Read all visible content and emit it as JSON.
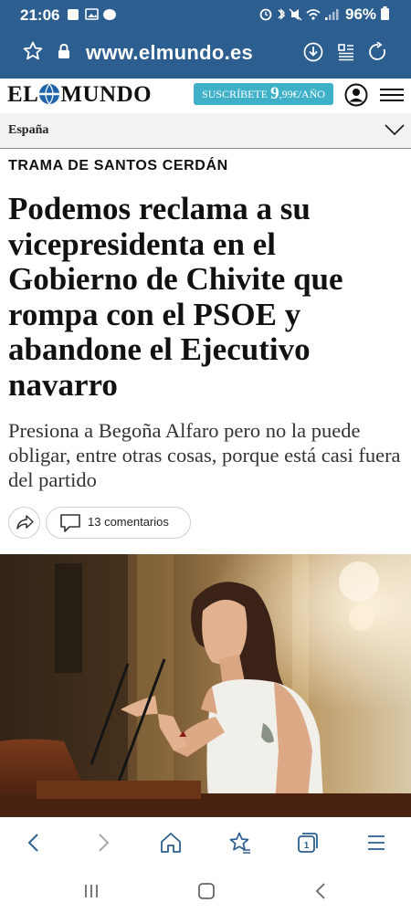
{
  "status_bar": {
    "time": "21:06",
    "battery": "96%",
    "left_icons": [
      "notification-icon",
      "image-icon",
      "chat-icon"
    ],
    "right_icons": [
      "alarm-icon",
      "bluetooth-icon",
      "mute-icon",
      "wifi-icon",
      "signal-icon",
      "battery-icon"
    ]
  },
  "browser": {
    "url": "www.elmundo.es"
  },
  "masthead": {
    "logo_left": "EL",
    "logo_right": "MUNDO",
    "subscribe_prefix": "SUSCRÍBETE",
    "subscribe_price": "9",
    "subscribe_suffix": ",99€/AÑO"
  },
  "section": {
    "label": "España"
  },
  "article": {
    "kicker": "TRAMA DE SANTOS CERDÁN",
    "headline": "Podemos reclama a su vicepresidenta en el Gobierno de Chivite que rompa con el PSOE y abandone el Ejecutivo navarro",
    "subheadline": "Presiona a Begoña Alfaro pero no la puede obligar, entre otras cosas, porque está casi fuera del partido",
    "comments_label": "13 comentarios"
  },
  "colors": {
    "browser_bar": "#2c5f90",
    "subscribe_bg": "#3eb1c8",
    "logo_globe": "#1f64a8"
  }
}
